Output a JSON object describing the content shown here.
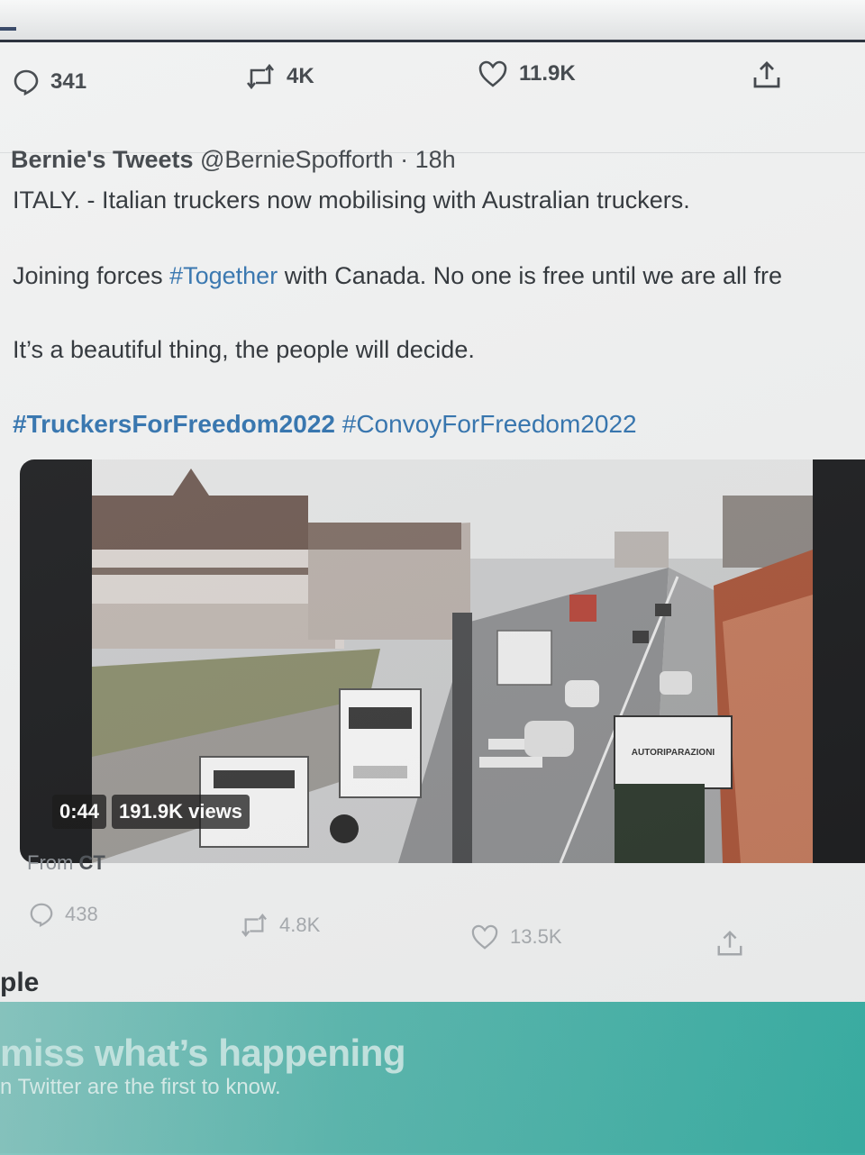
{
  "prev_tweet_actions": {
    "replies": "341",
    "retweets": "4K",
    "likes": "11.9K"
  },
  "tweet": {
    "author_name": "Bernie's Tweets",
    "handle": "@BernieSpofforth",
    "separator": "·",
    "time": "18h",
    "line1": "ITALY. -  Italian truckers now mobilising with Australian truckers.",
    "line2_prefix": "Joining forces ",
    "line2_hashtag": "#Together",
    "line2_suffix": " with Canada. No one is free until we are all fre",
    "line3": "It’s a beautiful thing, the people will decide.",
    "hashtag1": "#TruckersForFreedom2022",
    "hashtag2": "#ConvoyForFreedom2022",
    "video": {
      "duration": "0:44",
      "views": "191.9K views",
      "sign_text": "AUTORIPARAZIONI"
    },
    "from_label": "From",
    "from_source": "CT",
    "actions": {
      "replies": "438",
      "retweets": "4.8K",
      "likes": "13.5K"
    }
  },
  "sidebar_fragment": "ple",
  "banner": {
    "title": "miss what’s happening",
    "subtitle": "n Twitter are the first to know."
  },
  "colors": {
    "hashtag": "#2f71ad",
    "banner": "#3bb1a6"
  },
  "icons": [
    "reply-icon",
    "retweet-icon",
    "like-icon",
    "share-icon"
  ]
}
